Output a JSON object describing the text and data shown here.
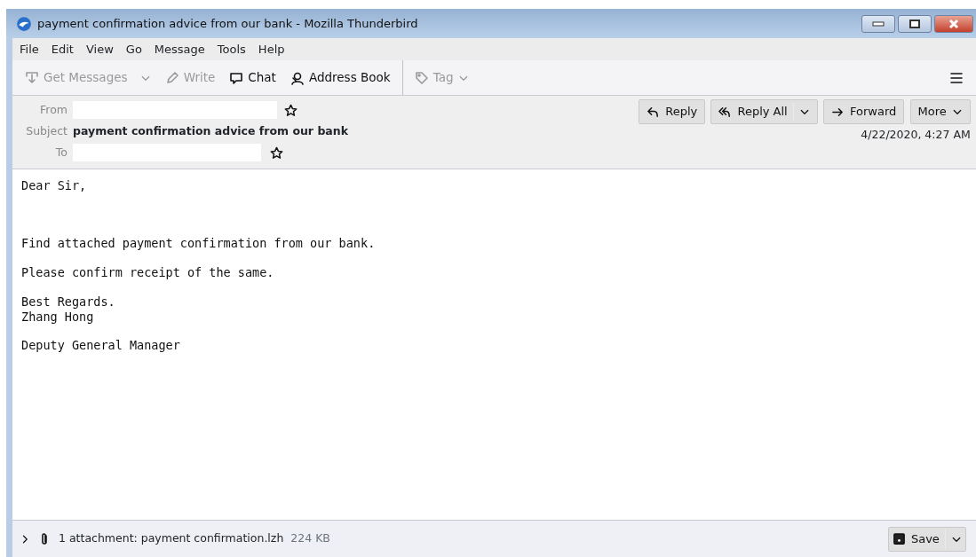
{
  "window": {
    "title": "payment confirmation advice from our bank - Mozilla Thunderbird"
  },
  "menu": [
    "File",
    "Edit",
    "View",
    "Go",
    "Message",
    "Tools",
    "Help"
  ],
  "toolbar": [
    {
      "kind": "get",
      "label": "Get Messages",
      "disabled": true,
      "dropdown": true
    },
    {
      "kind": "write",
      "label": "Write",
      "disabled": true,
      "dropdown": false
    },
    {
      "kind": "chat",
      "label": "Chat",
      "disabled": false,
      "dropdown": false
    },
    {
      "kind": "book",
      "label": "Address Book",
      "disabled": false,
      "dropdown": false
    },
    {
      "kind": "tag",
      "label": "Tag",
      "disabled": true,
      "dropdown": true
    }
  ],
  "header": {
    "from_label": "From",
    "subject_label": "Subject",
    "subject": "payment confirmation advice from our bank",
    "to_label": "To",
    "date": "4/22/2020, 4:27 AM",
    "actions": [
      {
        "kind": "reply",
        "label": "Reply",
        "dropdown": false
      },
      {
        "kind": "replyall",
        "label": "Reply All",
        "dropdown": true
      },
      {
        "kind": "forward",
        "label": "Forward",
        "dropdown": false
      },
      {
        "kind": "more",
        "label": "More",
        "dropdown": true
      }
    ]
  },
  "body": [
    "Dear Sir,",
    "Find attached payment confirmation from our bank.",
    "Please confirm receipt of the same.",
    "Best Regards.\nZhang Hong",
    "Deputy General Manager"
  ],
  "attachment": {
    "expanded": false,
    "summary": "1 attachment: payment confirmation.lzh",
    "size": "224 KB",
    "save": "Save"
  }
}
